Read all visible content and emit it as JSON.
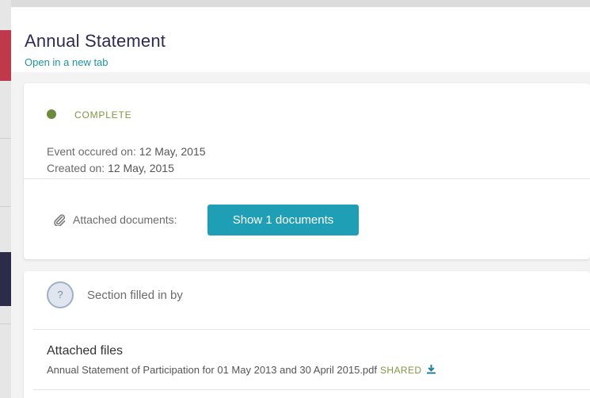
{
  "header": {
    "title": "Annual Statement",
    "open_link": "Open in a new tab"
  },
  "event": {
    "status": "COMPLETE",
    "status_color": "#6e8b3d",
    "occurred_label": "Event occured on: ",
    "occurred_value": "12 May, 2015",
    "created_label": "Created on: ",
    "created_value": "12 May, 2015",
    "attached_label": "Attached documents:",
    "attached_icon": "paperclip-icon",
    "show_button": "Show 1 documents",
    "accent_color": "#1f9fb5"
  },
  "section": {
    "filled_by_icon": "?",
    "filled_by_label": "Section filled in by",
    "files_heading": "Attached files",
    "files": [
      {
        "name": "Annual Statement of Participation for 01 May 2013 and 30 April 2015.pdf",
        "badge": "SHARED",
        "action_icon": "download-icon"
      }
    ]
  }
}
